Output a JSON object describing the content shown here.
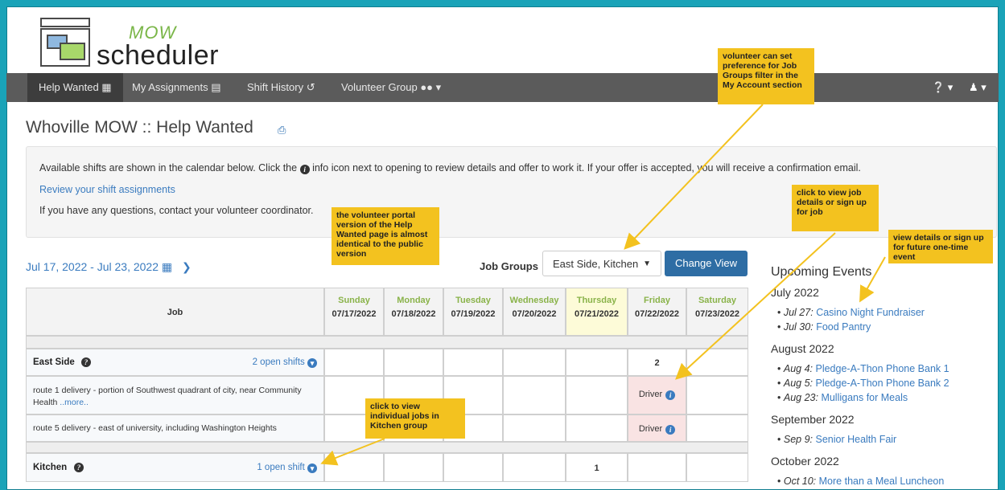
{
  "logo": {
    "mow": "MOW",
    "scheduler": "scheduler"
  },
  "nav": {
    "items": [
      {
        "label": "Help Wanted",
        "icon": "calendar-icon"
      },
      {
        "label": "My Assignments",
        "icon": "list-icon"
      },
      {
        "label": "Shift History",
        "icon": "history-icon"
      },
      {
        "label": "Volunteer Group",
        "icon": "users-icon"
      }
    ],
    "right": {
      "help_icon": "question-circle-icon",
      "user_icon": "user-icon"
    }
  },
  "page": {
    "title": "Whoville MOW :: Help Wanted",
    "print_icon": "print-icon"
  },
  "info": {
    "line1_a": "Available shifts are shown in the calendar below. Click the",
    "line1_b": "info icon next to opening to review details and offer to work it. If your offer is accepted, you will receive a confirmation email.",
    "review_link": "Review your shift assignments",
    "line3": "If you have any questions, contact your volunteer coordinator."
  },
  "controls": {
    "date_range": "Jul 17, 2022 - Jul 23, 2022",
    "job_groups_label": "Job Groups",
    "job_groups_value": "East Side, Kitchen",
    "change_view": "Change View"
  },
  "table": {
    "job_header": "Job",
    "days": [
      {
        "name": "Sunday",
        "date": "07/17/2022"
      },
      {
        "name": "Monday",
        "date": "07/18/2022"
      },
      {
        "name": "Tuesday",
        "date": "07/19/2022"
      },
      {
        "name": "Wednesday",
        "date": "07/20/2022"
      },
      {
        "name": "Thursday",
        "date": "07/21/2022"
      },
      {
        "name": "Friday",
        "date": "07/22/2022"
      },
      {
        "name": "Saturday",
        "date": "07/23/2022"
      }
    ],
    "east_side": {
      "label": "East Side",
      "open": "2 open shifts",
      "friday_count": "2"
    },
    "route1": {
      "desc": "route 1 delivery - portion of Southwest quadrant of city, near Community Health",
      "more": "..more..",
      "slot": "Driver"
    },
    "route5": {
      "desc": "route 5 delivery - east of university, including Washington Heights",
      "slot": "Driver"
    },
    "kitchen": {
      "label": "Kitchen",
      "open": "1 open shift",
      "thursday_count": "1"
    }
  },
  "events": {
    "title": "Upcoming Events",
    "months": [
      {
        "name": "July 2022",
        "items": [
          {
            "date": "Jul 27:",
            "name": "Casino Night Fundraiser"
          },
          {
            "date": "Jul 30:",
            "name": "Food Pantry"
          }
        ]
      },
      {
        "name": "August 2022",
        "items": [
          {
            "date": "Aug 4:",
            "name": "Pledge-A-Thon Phone Bank 1"
          },
          {
            "date": "Aug 5:",
            "name": "Pledge-A-Thon Phone Bank 2"
          },
          {
            "date": "Aug 23:",
            "name": "Mulligans for Meals"
          }
        ]
      },
      {
        "name": "September 2022",
        "items": [
          {
            "date": "Sep 9:",
            "name": "Senior Health Fair"
          }
        ]
      },
      {
        "name": "October 2022",
        "items": [
          {
            "date": "Oct 10:",
            "name": "More than a Meal Luncheon"
          }
        ]
      }
    ]
  },
  "callouts": {
    "job_groups": "volunteer can set preference for Job Groups filter in the My Account section",
    "portal": "the volunteer portal version of the Help Wanted page is almost identical to the public version",
    "job_details": "click to view job details or sign up for job",
    "events": "view details or sign up for future one-time event",
    "kitchen": "click to view individual jobs in Kitchen group"
  },
  "colors": {
    "accent": "#2e6da4",
    "navbar": "#5b5b5b",
    "callout": "#f3c21f",
    "day_green": "#8ab34a",
    "thursday_bg": "#fdfbd8",
    "friday_bg": "#f9e3e3",
    "frame": "#1aa3b8"
  }
}
